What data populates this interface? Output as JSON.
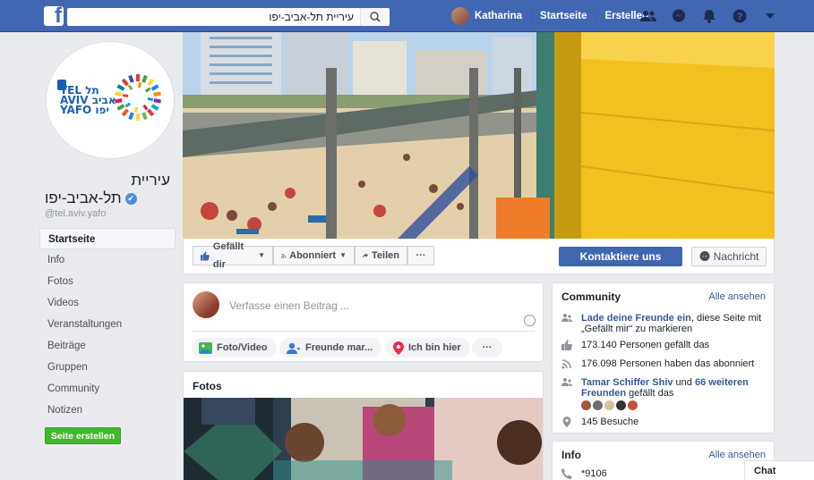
{
  "topbar": {
    "logo": "f",
    "search_value": "עיריית תל-אביב-יפו",
    "user_name": "Katharina",
    "nav_home": "Startseite",
    "nav_create": "Erstellen",
    "icons": [
      "friends-icon",
      "messenger-icon",
      "notifications-icon",
      "help-icon",
      "chevron-down-icon"
    ],
    "colors": {
      "bar": "#4267b2"
    }
  },
  "page": {
    "logo_text_line1": "TEL תל",
    "logo_text_line2": "AVIV אביב",
    "logo_text_line3": "YAFO יפו",
    "name_line1": "עיריית",
    "name_line2": "תל-אביב-יפו",
    "verified": "✔",
    "handle": "@tel.aviv.yafo"
  },
  "menu": {
    "items": [
      "Startseite",
      "Info",
      "Fotos",
      "Videos",
      "Veranstaltungen",
      "Beiträge",
      "Gruppen",
      "Community",
      "Notizen"
    ],
    "create_page": "Seite erstellen"
  },
  "actions": {
    "like": "Gefällt dir",
    "follow": "Abonniert",
    "share": "Teilen",
    "more": "···",
    "contact": "Kontaktiere uns",
    "message": "Nachricht"
  },
  "composer": {
    "placeholder": "Verfasse einen Beitrag ...",
    "photo_video": "Foto/Video",
    "tag_friends": "Freunde mar...",
    "checkin": "Ich bin hier",
    "more": "···"
  },
  "photos": {
    "title": "Fotos"
  },
  "community": {
    "title": "Community",
    "see_all": "Alle ansehen",
    "invite_link": "Lade deine Freunde ein",
    "invite_rest": ", diese Seite mit „Gefällt mir“ zu markieren",
    "likes": "173.140 Personen gefällt das",
    "follows": "176.098 Personen haben das abonniert",
    "friend1": "Tamar Schiffer Shiv",
    "friend_mid": " und ",
    "friend2": "66 weiteren Freunden",
    "friend_rest": " gefällt das",
    "visits": "145 Besuche"
  },
  "info": {
    "title": "Info",
    "see_all": "Alle ansehen",
    "phone": "*9106"
  },
  "chat": {
    "label": "Chat"
  }
}
